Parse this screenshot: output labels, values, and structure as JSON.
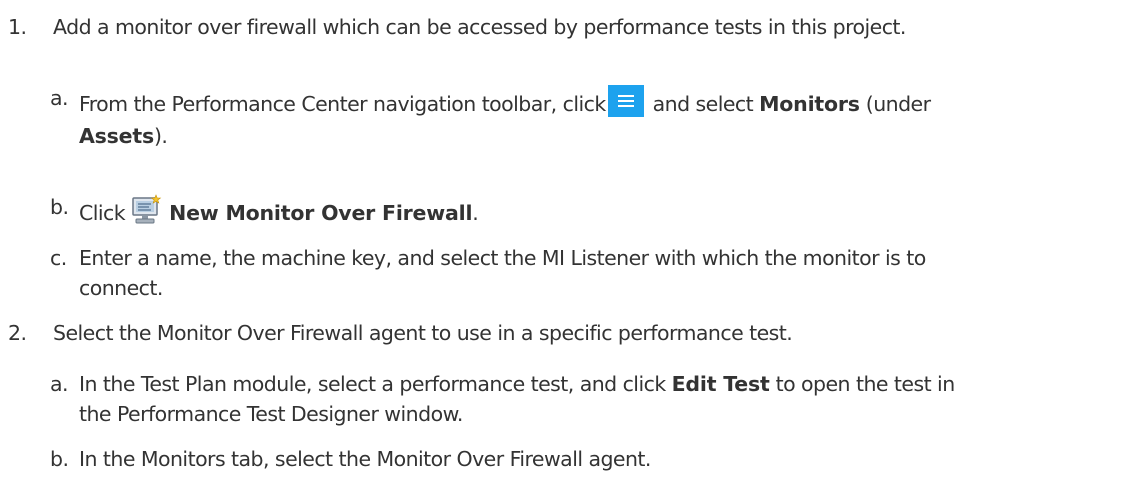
{
  "steps": [
    {
      "number": "1.",
      "text": "Add a monitor over firewall which can be accessed by performance tests in this project.",
      "substeps": [
        {
          "letter": "a.",
          "line1_before": "From the Performance Center navigation toolbar, click",
          "line1_after": " and select ",
          "line1_bold": "Monitors",
          "line1_end": " (under",
          "line2_bold": "Assets",
          "line2_end": ").",
          "icon": "menu-icon"
        },
        {
          "letter": "b.",
          "before": "Click",
          "bold": "New Monitor Over Firewall",
          "after": ".",
          "icon": "new-monitor-icon"
        },
        {
          "letter": "c.",
          "line1": "Enter a name, the machine key, and select the MI Listener with which the monitor is to",
          "line2": "connect."
        }
      ]
    },
    {
      "number": "2.",
      "text": "Select the Monitor Over Firewall agent to use in a specific performance test.",
      "substeps": [
        {
          "letter": "a.",
          "line1_before": "In the Test Plan module, select a performance test, and click ",
          "line1_bold": "Edit Test",
          "line1_after": " to open the test in",
          "line2": "the Performance Test Designer window."
        },
        {
          "letter": "b.",
          "text": "In the Monitors tab, select the Monitor Over Firewall agent."
        }
      ]
    }
  ]
}
